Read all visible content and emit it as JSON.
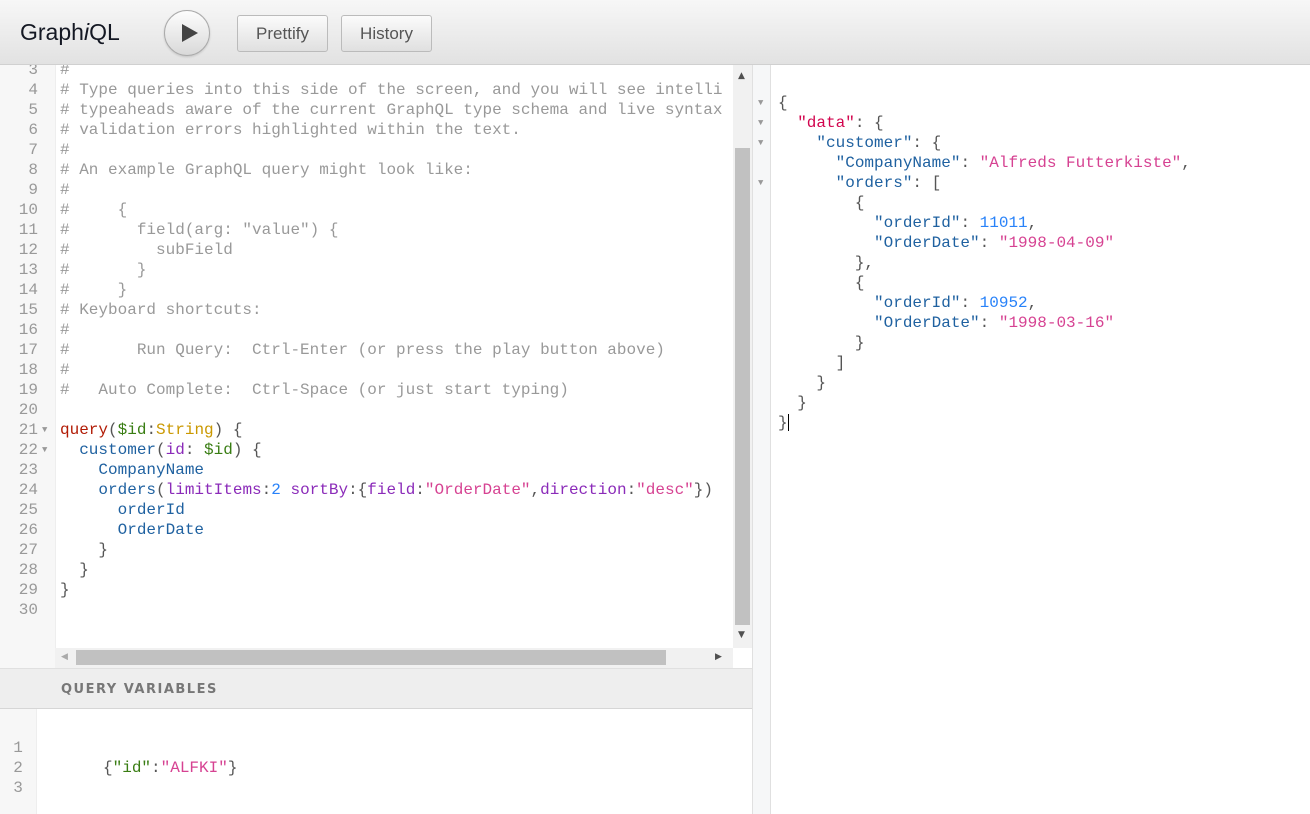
{
  "toolbar": {
    "title_prefix": "Graph",
    "title_italic": "i",
    "title_suffix": "QL",
    "run_icon": "play-icon",
    "prettify_label": "Prettify",
    "history_label": "History"
  },
  "query_editor": {
    "lines": [
      {
        "n": "3",
        "t": [
          [
            "comment",
            "#"
          ]
        ]
      },
      {
        "n": "4",
        "t": [
          [
            "comment",
            "# Type queries into this side of the screen, and you will see intelli"
          ]
        ]
      },
      {
        "n": "5",
        "t": [
          [
            "comment",
            "# typeaheads aware of the current GraphQL type schema and live syntax"
          ]
        ]
      },
      {
        "n": "6",
        "t": [
          [
            "comment",
            "# validation errors highlighted within the text."
          ]
        ]
      },
      {
        "n": "7",
        "t": [
          [
            "comment",
            "#"
          ]
        ]
      },
      {
        "n": "8",
        "t": [
          [
            "comment",
            "# An example GraphQL query might look like:"
          ]
        ]
      },
      {
        "n": "9",
        "t": [
          [
            "comment",
            "#"
          ]
        ]
      },
      {
        "n": "10",
        "t": [
          [
            "comment",
            "#     {"
          ]
        ]
      },
      {
        "n": "11",
        "t": [
          [
            "comment",
            "#       field(arg: \"value\") {"
          ]
        ]
      },
      {
        "n": "12",
        "t": [
          [
            "comment",
            "#         subField"
          ]
        ]
      },
      {
        "n": "13",
        "t": [
          [
            "comment",
            "#       }"
          ]
        ]
      },
      {
        "n": "14",
        "t": [
          [
            "comment",
            "#     }"
          ]
        ]
      },
      {
        "n": "15",
        "t": [
          [
            "comment",
            "# Keyboard shortcuts:"
          ]
        ]
      },
      {
        "n": "16",
        "t": [
          [
            "comment",
            "#"
          ]
        ]
      },
      {
        "n": "17",
        "t": [
          [
            "comment",
            "#       Run Query:  Ctrl-Enter (or press the play button above)"
          ]
        ]
      },
      {
        "n": "18",
        "t": [
          [
            "comment",
            "#"
          ]
        ]
      },
      {
        "n": "19",
        "t": [
          [
            "comment",
            "#   Auto Complete:  Ctrl-Space (or just start typing)"
          ]
        ]
      },
      {
        "n": "20",
        "t": []
      },
      {
        "n": "21",
        "fold": true,
        "t": [
          [
            "keyword",
            "query"
          ],
          [
            "punct",
            "("
          ],
          [
            "variable",
            "$id"
          ],
          [
            "punct",
            ":"
          ],
          [
            "atom",
            "String"
          ],
          [
            "punct",
            ") {"
          ]
        ]
      },
      {
        "n": "22",
        "fold": true,
        "t": [
          [
            "property",
            "  customer"
          ],
          [
            "punct",
            "("
          ],
          [
            "attribute",
            "id"
          ],
          [
            "punct",
            ": "
          ],
          [
            "variable",
            "$id"
          ],
          [
            "punct",
            ") {"
          ]
        ]
      },
      {
        "n": "23",
        "t": [
          [
            "property",
            "    CompanyName"
          ]
        ]
      },
      {
        "n": "24",
        "t": [
          [
            "property",
            "    orders"
          ],
          [
            "punct",
            "("
          ],
          [
            "attribute",
            "limitItems"
          ],
          [
            "punct",
            ":"
          ],
          [
            "number",
            "2"
          ],
          [
            "punct",
            " "
          ],
          [
            "attribute",
            "sortBy"
          ],
          [
            "punct",
            ":{"
          ],
          [
            "attribute",
            "field"
          ],
          [
            "punct",
            ":"
          ],
          [
            "string",
            "\"OrderDate\""
          ],
          [
            "punct",
            ","
          ],
          [
            "attribute",
            "direction"
          ],
          [
            "punct",
            ":"
          ],
          [
            "string",
            "\"desc\""
          ],
          [
            "punct",
            "})"
          ]
        ]
      },
      {
        "n": "25",
        "t": [
          [
            "property",
            "      orderId"
          ]
        ]
      },
      {
        "n": "26",
        "t": [
          [
            "property",
            "      OrderDate"
          ]
        ]
      },
      {
        "n": "27",
        "t": [
          [
            "punct",
            "    }"
          ]
        ]
      },
      {
        "n": "28",
        "t": [
          [
            "punct",
            "  }"
          ]
        ]
      },
      {
        "n": "29",
        "t": [
          [
            "punct",
            "}"
          ]
        ]
      },
      {
        "n": "30",
        "t": []
      }
    ]
  },
  "variables": {
    "title": "QUERY VARIABLES",
    "lines": [
      {
        "n": "1",
        "t": []
      },
      {
        "n": "2",
        "t": [
          [
            "punct",
            "{"
          ],
          [
            "variable",
            "\"id\""
          ],
          [
            "punct",
            ":"
          ],
          [
            "string",
            "\"ALFKI\""
          ],
          [
            "punct",
            "}"
          ]
        ]
      },
      {
        "n": "3",
        "t": []
      }
    ]
  },
  "result": {
    "lines": [
      {
        "fold": true,
        "t": [
          [
            "punct",
            "{"
          ]
        ]
      },
      {
        "fold": true,
        "t": [
          [
            "punct",
            "  "
          ],
          [
            "def",
            "\"data\""
          ],
          [
            "punct",
            ": {"
          ]
        ]
      },
      {
        "fold": true,
        "t": [
          [
            "punct",
            "    "
          ],
          [
            "property",
            "\"customer\""
          ],
          [
            "punct",
            ": {"
          ]
        ]
      },
      {
        "t": [
          [
            "punct",
            "      "
          ],
          [
            "property",
            "\"CompanyName\""
          ],
          [
            "punct",
            ": "
          ],
          [
            "string",
            "\"Alfreds Futterkiste\""
          ],
          [
            "punct",
            ","
          ]
        ]
      },
      {
        "fold": true,
        "t": [
          [
            "punct",
            "      "
          ],
          [
            "property",
            "\"orders\""
          ],
          [
            "punct",
            ": ["
          ]
        ]
      },
      {
        "t": [
          [
            "punct",
            "        {"
          ]
        ]
      },
      {
        "t": [
          [
            "punct",
            "          "
          ],
          [
            "property",
            "\"orderId\""
          ],
          [
            "punct",
            ": "
          ],
          [
            "number",
            "11011"
          ],
          [
            "punct",
            ","
          ]
        ]
      },
      {
        "t": [
          [
            "punct",
            "          "
          ],
          [
            "property",
            "\"OrderDate\""
          ],
          [
            "punct",
            ": "
          ],
          [
            "string",
            "\"1998-04-09\""
          ]
        ]
      },
      {
        "t": [
          [
            "punct",
            "        },"
          ]
        ]
      },
      {
        "t": [
          [
            "punct",
            "        {"
          ]
        ]
      },
      {
        "t": [
          [
            "punct",
            "          "
          ],
          [
            "property",
            "\"orderId\""
          ],
          [
            "punct",
            ": "
          ],
          [
            "number",
            "10952"
          ],
          [
            "punct",
            ","
          ]
        ]
      },
      {
        "t": [
          [
            "punct",
            "          "
          ],
          [
            "property",
            "\"OrderDate\""
          ],
          [
            "punct",
            ": "
          ],
          [
            "string",
            "\"1998-03-16\""
          ]
        ]
      },
      {
        "t": [
          [
            "punct",
            "        }"
          ]
        ]
      },
      {
        "t": [
          [
            "punct",
            "      ]"
          ]
        ]
      },
      {
        "t": [
          [
            "punct",
            "    }"
          ]
        ]
      },
      {
        "t": [
          [
            "punct",
            "  }"
          ]
        ]
      },
      {
        "cursor": true,
        "t": [
          [
            "punct",
            "}"
          ]
        ]
      }
    ]
  }
}
